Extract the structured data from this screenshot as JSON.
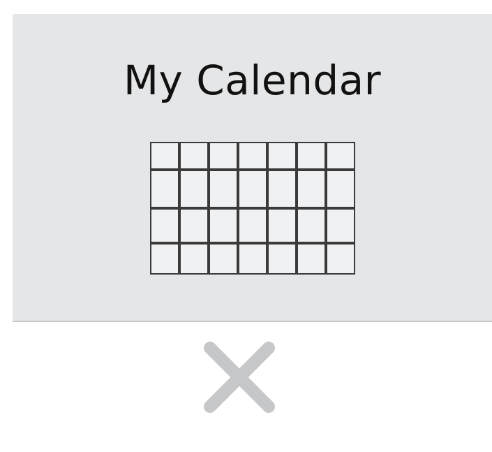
{
  "title": "My Calendar",
  "icons": {
    "calendar": "calendar-icon",
    "close": "close-icon"
  },
  "colors": {
    "top_panel": "#e5e6e8",
    "calendar_fill": "#f0f1f3",
    "calendar_grid": "#3a3a3a",
    "close_icon": "#c6c7c9"
  }
}
